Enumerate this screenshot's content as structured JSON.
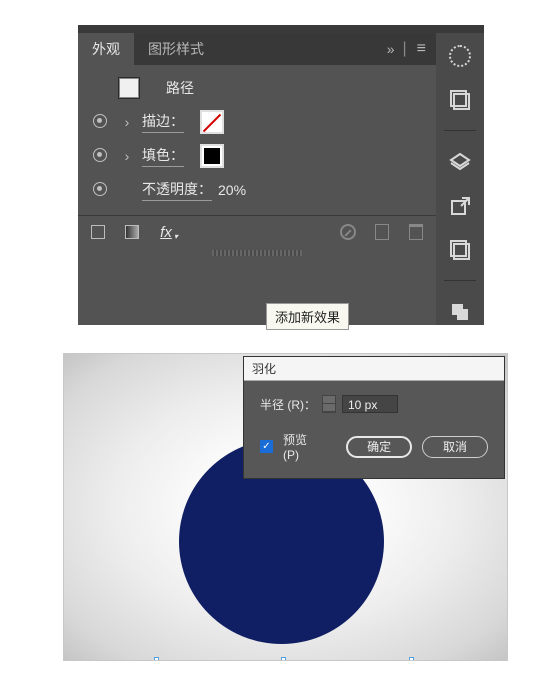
{
  "appearance_panel": {
    "tabs": {
      "appearance": "外观",
      "graphic_styles": "图形样式"
    },
    "expand_glyph": "»",
    "menu_glyph": "≡",
    "rows": {
      "object_label": "路径",
      "stroke_label": "描边：",
      "fill_label": "填色：",
      "opacity_label": "不透明度：",
      "opacity_value": "20%"
    },
    "fx_label": "fx",
    "tooltip": "添加新效果"
  },
  "icon_column": {
    "items": [
      "feather-icon",
      "artboards-icon",
      "layers-icon",
      "share-icon",
      "pathfinder-icon",
      "transform-icon"
    ]
  },
  "feather_dialog": {
    "title": "羽化",
    "radius_label": "半径 (R)：",
    "radius_value": "10 px",
    "preview_label": "预览 (P)",
    "preview_checked": true,
    "ok_label": "确定",
    "cancel_label": "取消"
  },
  "canvas": {
    "circle_color": "#101f63"
  }
}
